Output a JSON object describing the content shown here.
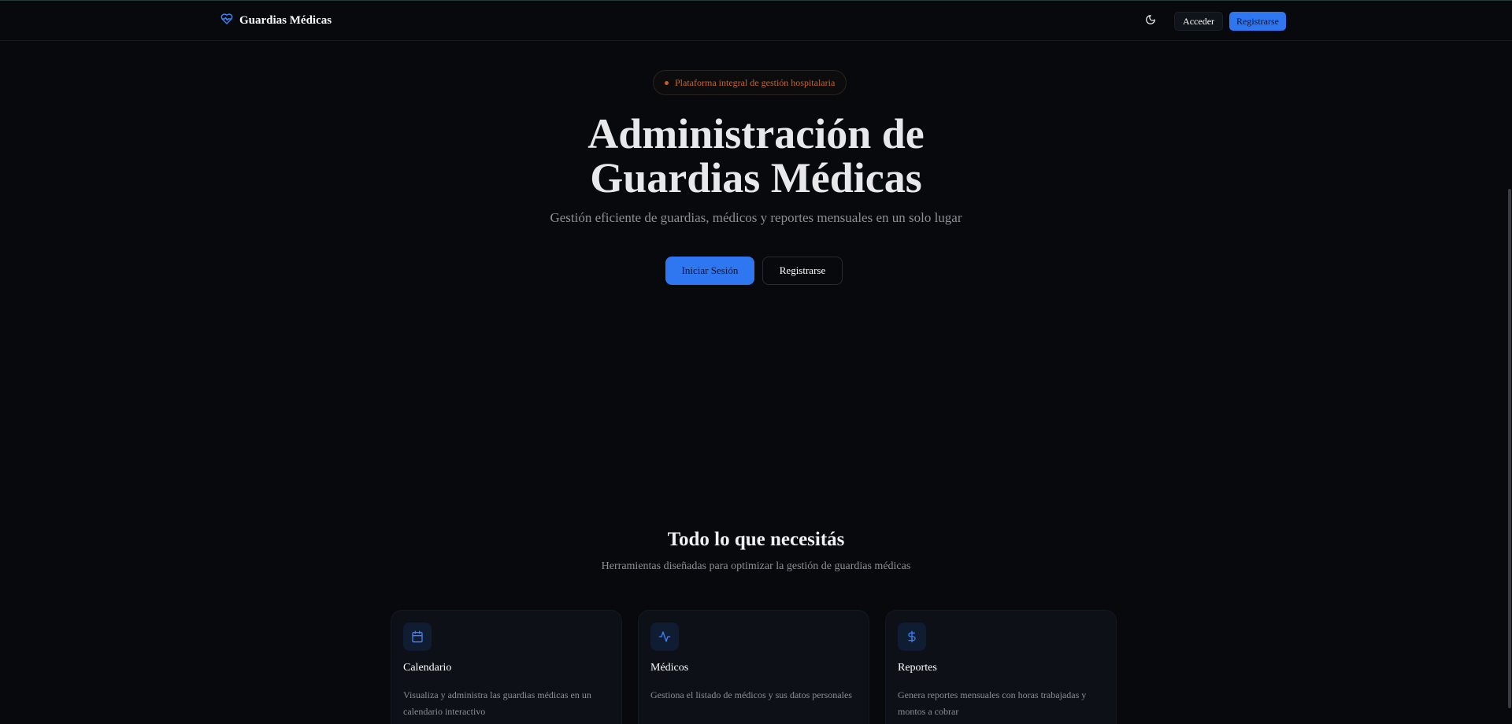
{
  "header": {
    "brand": "Guardias Médicas",
    "login_label": "Acceder",
    "register_label": "Registrarse",
    "brand_icon": "heart-pulse-icon",
    "theme_icon": "moon-icon"
  },
  "hero": {
    "badge": "Plataforma integral de gestión hospitalaria",
    "title_line1": "Administración de",
    "title_line2": "Guardias Médicas",
    "subtitle": "Gestión eficiente de guardias, médicos y reportes mensuales en un solo lugar",
    "primary_cta": "Iniciar Sesión",
    "secondary_cta": "Registrarse"
  },
  "features": {
    "title": "Todo lo que necesitás",
    "subtitle": "Herramientas diseñadas para optimizar la gestión de guardias médicas",
    "cards": [
      {
        "icon": "calendar-icon",
        "title": "Calendario",
        "desc": "Visualiza y administra las guardias médicas en un calendario interactivo"
      },
      {
        "icon": "activity-icon",
        "title": "Médicos",
        "desc": "Gestiona el listado de médicos y sus datos personales"
      },
      {
        "icon": "dollar-icon",
        "title": "Reportes",
        "desc": "Genera reportes mensuales con horas trabajadas y montos a cobrar"
      }
    ]
  },
  "colors": {
    "background": "#07090d",
    "accent": "#2f77f0",
    "badge": "#c8642e"
  }
}
